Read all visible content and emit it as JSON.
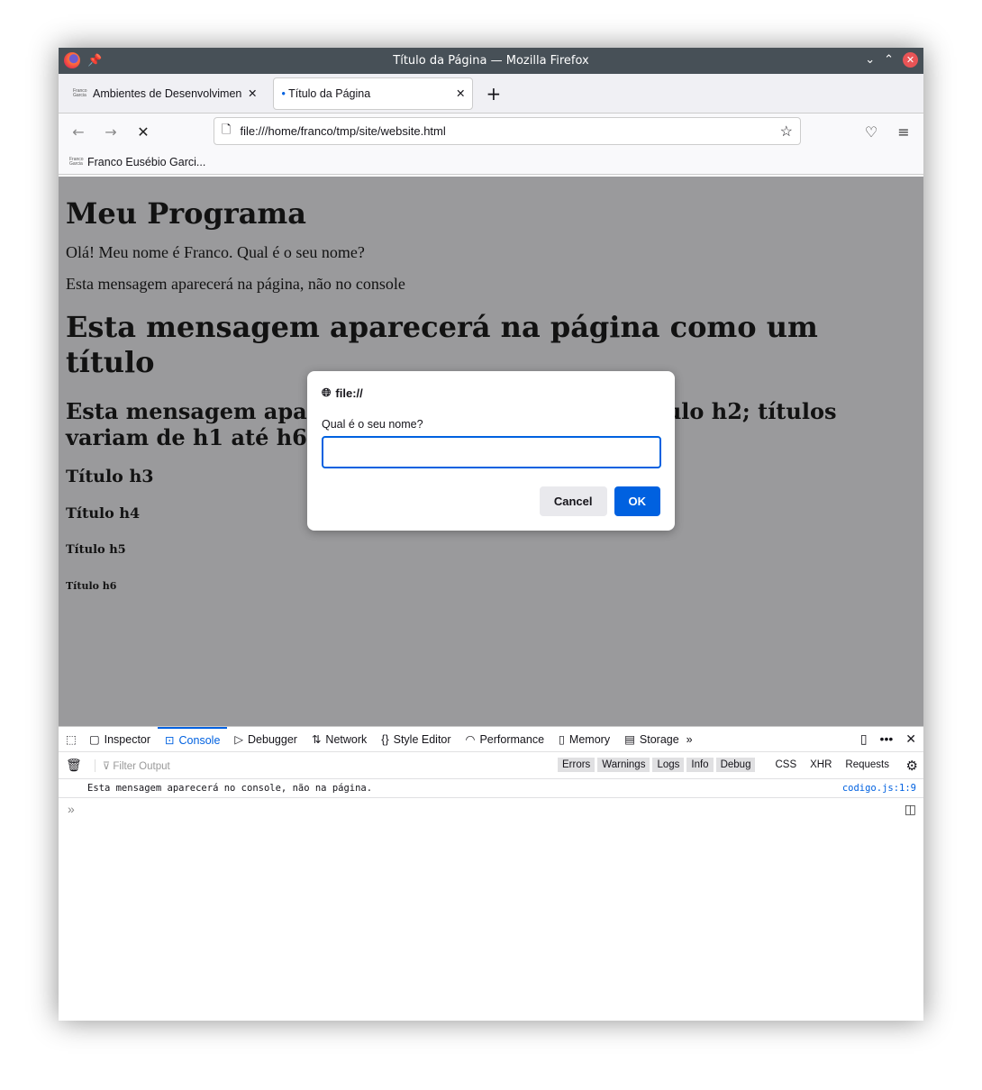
{
  "window": {
    "title": "Título da Página — Mozilla Firefox"
  },
  "tabs": [
    {
      "label": "Ambientes de Desenvolvimen",
      "favicon": "Franco Garcia"
    },
    {
      "label": "Título da Página"
    }
  ],
  "url": "file:///home/franco/tmp/site/website.html",
  "bookmarks": [
    {
      "label": "Franco Eusébio Garci...",
      "favicon": "Franco Garcia"
    }
  ],
  "page": {
    "h1": "Meu Programa",
    "p1": "Olá! Meu nome é Franco. Qual é o seu nome?",
    "p2": "Esta mensagem aparecerá na página, não no console",
    "h1b": "Esta mensagem aparecerá na página como um título",
    "h2": "Esta mensagem aparecerá na página como um título h2; títulos variam de h1 até h6",
    "h3": "Título h3",
    "h4": "Título h4",
    "h5": "Título h5",
    "h6": "Título h6"
  },
  "dialog": {
    "origin": "file://",
    "question": "Qual é o seu nome?",
    "value": "",
    "cancel": "Cancel",
    "ok": "OK"
  },
  "devtools": {
    "tabs": [
      "Inspector",
      "Console",
      "Debugger",
      "Network",
      "Style Editor",
      "Performance",
      "Memory",
      "Storage"
    ],
    "active": "Console",
    "filter_placeholder": "Filter Output",
    "levels": [
      "Errors",
      "Warnings",
      "Logs",
      "Info",
      "Debug"
    ],
    "types": [
      "CSS",
      "XHR",
      "Requests"
    ],
    "messages": [
      {
        "text": "Esta mensagem aparecerá no console, não na página.",
        "source": "codigo.js:1:9"
      }
    ]
  },
  "colors": {
    "accent": "#0061e0",
    "titlebar": "#475057",
    "overlay": "#9a9a9c"
  }
}
